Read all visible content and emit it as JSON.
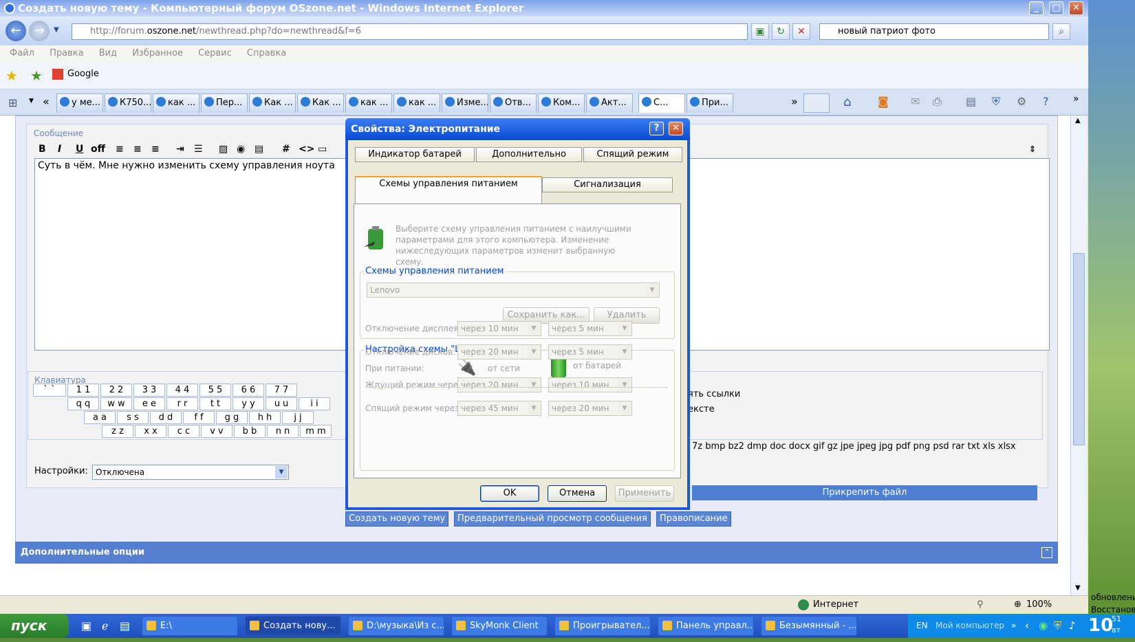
{
  "window": {
    "title": "Создать новую тему - Компьютерный форум OSzone.net - Windows Internet Explorer"
  },
  "address": {
    "url_pre": "http://forum.",
    "url_host": "oszone.net",
    "url_post": "/newthread.php?do=newthread&f=6",
    "search": "новый патриот фото"
  },
  "menu": [
    "Файл",
    "Правка",
    "Вид",
    "Избранное",
    "Сервис",
    "Справка"
  ],
  "favorites": {
    "google": "Google"
  },
  "tabs": [
    "у ме...",
    "К750...",
    "как ...",
    "Пер...",
    "Как ...",
    "Как ...",
    "как ...",
    "как ...",
    "Изме...",
    "Отв...",
    "Ком...",
    "Акт...",
    "С...",
    "При..."
  ],
  "page": {
    "message_label": "Сообщение",
    "message_text": "Суть в чём. Мне нужно изменить схему управления ноута",
    "keyboard_label": "Клавиатура",
    "keyboard_rows": [
      [
        "` `",
        "1 1",
        "2 2",
        "3 3",
        "4 4",
        "5 5",
        "6 6",
        "7 7"
      ],
      [
        "q q",
        "w w",
        "e e",
        "r r",
        "t t",
        "y y",
        "u u",
        "i i"
      ],
      [
        "a a",
        "s s",
        "d d",
        "f f",
        "g g",
        "h h",
        "j j"
      ],
      [
        "z z",
        "x x",
        "c c",
        "v v",
        "b b",
        "n n",
        "m m"
      ]
    ],
    "settings_label": "Настройки:",
    "settings_value": "Отключена",
    "right_text1": "ять ссылки",
    "right_text2": "ексте",
    "file_types": "7z bmp bz2 dmp doc docx gif gz jpe jpeg jpg pdf png psd rar txt xls xlsx",
    "attach_button": "Прикрепить файл",
    "create_button": "Создать новую тему",
    "preview_button": "Предварительный просмотр сообщения",
    "spell_button": "Правописание",
    "extra_options": "Дополнительные опции",
    "toolbar_off": "off"
  },
  "dialog": {
    "title": "Свойства: Электропитание",
    "tabs_row1": [
      "Индикатор батарей",
      "Дополнительно",
      "Спящий режим"
    ],
    "tabs_row2": [
      "Схемы управления питанием",
      "Сигнализация"
    ],
    "description": "Выберите схему управления питанием с наилучшими параметрами для этого компьютера. Изменение нижеследующих параметров изменит выбранную схему.",
    "schemes_group": "Схемы управления питанием",
    "scheme_value": "Lenovo",
    "save_as": "Сохранить как...",
    "delete": "Удалить",
    "settings_group": "Настройка схемы \"Lenovo\"",
    "when_label": "При питании:",
    "ac_label": "от сети",
    "battery_label": "от батарей",
    "rows": [
      {
        "label": "Отключение дисплея:",
        "ac": "через 10 мин",
        "dc": "через 5 мин"
      },
      {
        "label": "Отключение дисков:",
        "ac": "через 20 мин",
        "dc": "через 5 мин"
      },
      {
        "label": "Ждущий режим через:",
        "ac": "через 20 мин",
        "dc": "через 10 мин"
      },
      {
        "label": "Спящий режим через:",
        "ac": "через 45 мин",
        "dc": "через 20 мин"
      }
    ],
    "ok": "OK",
    "cancel": "Отмена",
    "apply": "Применить"
  },
  "status": {
    "zone": "Интернет",
    "zoom": "100%"
  },
  "taskbar": {
    "start": "пуск",
    "tasks": [
      "E:\\",
      "Создать нову...",
      "D:\\музыка\\Из с...",
      "SkyMonk Client",
      "Проигрывател...",
      "Панель управл...",
      "Безымянный - ..."
    ],
    "lang": "EN",
    "my_computer": "Мой компьютер",
    "time": "10",
    "time_sup": "51",
    "time_sub": "вт"
  },
  "desktop": {
    "text1": "обновление",
    "text2": "Восстанов"
  }
}
